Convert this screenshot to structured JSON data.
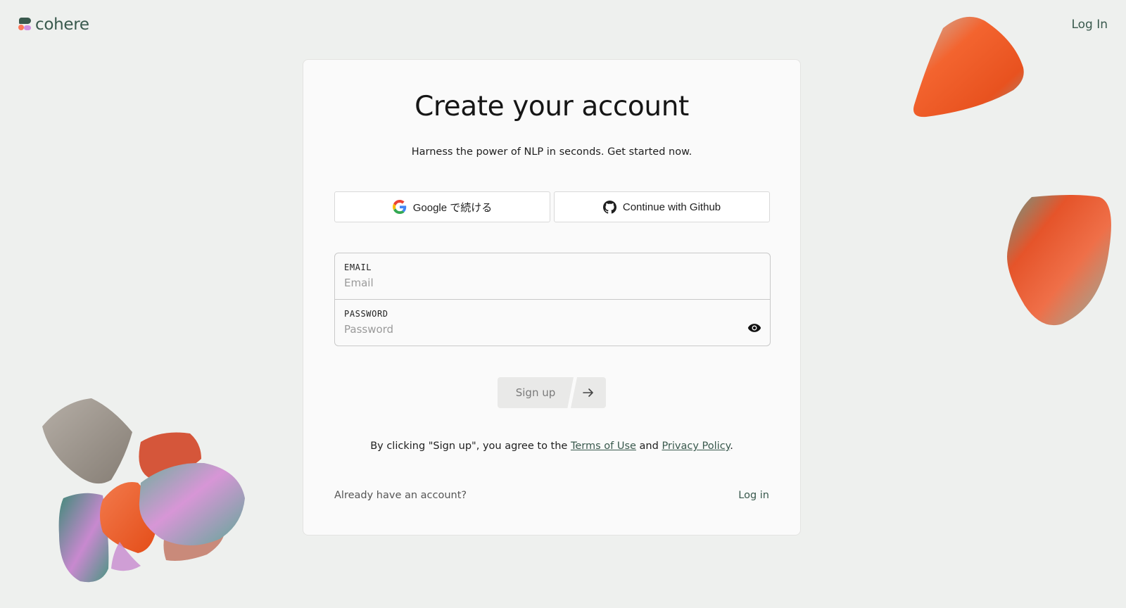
{
  "header": {
    "logo_text": "cohere",
    "login_link": "Log In"
  },
  "card": {
    "title": "Create your account",
    "subtitle": "Harness the power of NLP in seconds. Get started now.",
    "oauth": {
      "google_label": "Google で続ける",
      "github_label": "Continue with Github"
    },
    "email": {
      "label": "EMAIL",
      "value": "",
      "placeholder": "Email"
    },
    "password": {
      "label": "PASSWORD",
      "value": "",
      "placeholder": "Password"
    },
    "signup_label": "Sign up",
    "terms": {
      "prefix": "By clicking \"Sign up\", you agree to the ",
      "terms_link": "Terms of Use",
      "middle": " and ",
      "privacy_link": "Privacy Policy",
      "suffix": "."
    },
    "footer": {
      "already_text": "Already have an account?",
      "login_link": "Log in"
    }
  },
  "icons": {
    "google": "google-icon",
    "github": "github-icon",
    "eye": "eye-icon",
    "arrow": "arrow-right-icon"
  },
  "colors": {
    "brand_green": "#39594d",
    "coral": "#ff7759",
    "background": "#eef0ee",
    "card": "#fafafa"
  }
}
